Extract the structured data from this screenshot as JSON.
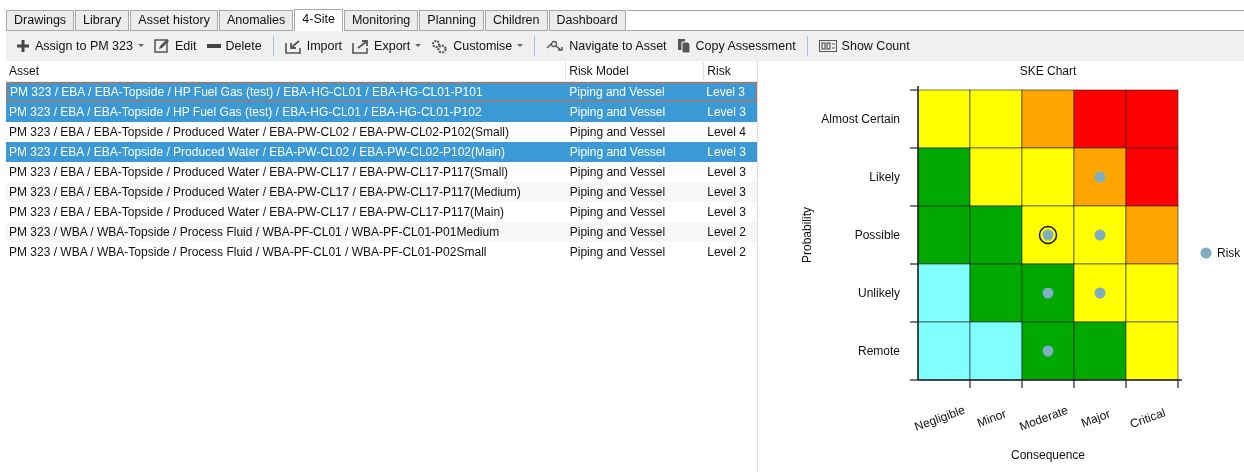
{
  "tabs": [
    {
      "label": "Drawings",
      "selected": false
    },
    {
      "label": "Library",
      "selected": false
    },
    {
      "label": "Asset history",
      "selected": false
    },
    {
      "label": "Anomalies",
      "selected": false
    },
    {
      "label": "4-Site",
      "selected": true
    },
    {
      "label": "Monitoring",
      "selected": false
    },
    {
      "label": "Planning",
      "selected": false
    },
    {
      "label": "Children",
      "selected": false
    },
    {
      "label": "Dashboard",
      "selected": false
    }
  ],
  "toolbar": [
    [
      {
        "label": "Assign to PM 323",
        "dropdown": true
      },
      {
        "label": "Edit",
        "dropdown": false
      },
      {
        "label": "Delete",
        "dropdown": false
      }
    ],
    [
      {
        "label": "Import",
        "dropdown": false
      },
      {
        "label": "Export",
        "dropdown": true
      },
      {
        "label": "Customise",
        "dropdown": true
      }
    ],
    [
      {
        "label": "Navigate to Asset",
        "dropdown": false
      },
      {
        "label": "Copy Assessment",
        "dropdown": false
      }
    ],
    [
      {
        "label": "Show Count",
        "dropdown": false
      }
    ]
  ],
  "table": {
    "columns": [
      "Asset",
      "Risk Model",
      "Risk"
    ],
    "rows": [
      {
        "cells": [
          "PM 323 / EBA / EBA-Topside / HP Fuel Gas (test) / EBA-HG-CL01 / EBA-HG-CL01-P101",
          "Piping and Vessel",
          "Level 3"
        ],
        "selected": true,
        "focused": true
      },
      {
        "cells": [
          "PM 323 / EBA / EBA-Topside / HP Fuel Gas (test) / EBA-HG-CL01 / EBA-HG-CL01-P102",
          "Piping and Vessel",
          "Level 3"
        ],
        "selected": true,
        "focused": false
      },
      {
        "cells": [
          "PM 323 / EBA / EBA-Topside / Produced Water / EBA-PW-CL02 / EBA-PW-CL02-P102(Small)",
          "Piping and Vessel",
          "Level 4"
        ],
        "selected": false,
        "focused": false
      },
      {
        "cells": [
          "PM 323 / EBA / EBA-Topside / Produced Water / EBA-PW-CL02 / EBA-PW-CL02-P102(Main)",
          "Piping and Vessel",
          "Level 3"
        ],
        "selected": true,
        "focused": false
      },
      {
        "cells": [
          "PM 323 / EBA / EBA-Topside / Produced Water / EBA-PW-CL17 / EBA-PW-CL17-P117(Small)",
          "Piping and Vessel",
          "Level 3"
        ],
        "selected": false,
        "focused": false
      },
      {
        "cells": [
          "PM 323 / EBA / EBA-Topside / Produced Water / EBA-PW-CL17 / EBA-PW-CL17-P117(Medium)",
          "Piping and Vessel",
          "Level 3"
        ],
        "selected": false,
        "focused": false
      },
      {
        "cells": [
          "PM 323 / EBA / EBA-Topside / Produced Water / EBA-PW-CL17 / EBA-PW-CL17-P117(Main)",
          "Piping and Vessel",
          "Level 3"
        ],
        "selected": false,
        "focused": false
      },
      {
        "cells": [
          "PM 323 / WBA / WBA-Topside / Process Fluid / WBA-PF-CL01 / WBA-PF-CL01-P01Medium",
          "Piping and Vessel",
          "Level 2"
        ],
        "selected": false,
        "focused": false
      },
      {
        "cells": [
          "PM 323 / WBA / WBA-Topside / Process Fluid / WBA-PF-CL01 / WBA-PF-CL01-P02Small",
          "Piping and Vessel",
          "Level 2"
        ],
        "selected": false,
        "focused": false
      }
    ]
  },
  "risk_matrix": {
    "title": "SKE Chart",
    "xlabel": "Consequence",
    "ylabel": "Probability",
    "columns": [
      "Negligible",
      "Minor",
      "Moderate",
      "Major",
      "Critical"
    ],
    "rows": [
      {
        "label": "Almost Certain",
        "cells": [
          {
            "color": "#ffff00",
            "marked": false,
            "selected": false
          },
          {
            "color": "#ffff00",
            "marked": false,
            "selected": false
          },
          {
            "color": "#ffa500",
            "marked": false,
            "selected": false
          },
          {
            "color": "#ff0000",
            "marked": false,
            "selected": false
          },
          {
            "color": "#ff0000",
            "marked": false,
            "selected": false
          }
        ]
      },
      {
        "label": "Likely",
        "cells": [
          {
            "color": "#00a800",
            "marked": false,
            "selected": false
          },
          {
            "color": "#ffff00",
            "marked": false,
            "selected": false
          },
          {
            "color": "#ffff00",
            "marked": false,
            "selected": false
          },
          {
            "color": "#ffa500",
            "marked": true,
            "selected": false
          },
          {
            "color": "#ff0000",
            "marked": false,
            "selected": false
          }
        ]
      },
      {
        "label": "Possible",
        "cells": [
          {
            "color": "#00a800",
            "marked": false,
            "selected": false
          },
          {
            "color": "#00a800",
            "marked": false,
            "selected": false
          },
          {
            "color": "#ffff00",
            "marked": true,
            "selected": true
          },
          {
            "color": "#ffff00",
            "marked": true,
            "selected": false
          },
          {
            "color": "#ffa500",
            "marked": false,
            "selected": false
          }
        ]
      },
      {
        "label": "Unlikely",
        "cells": [
          {
            "color": "#80ffff",
            "marked": false,
            "selected": false
          },
          {
            "color": "#00a800",
            "marked": false,
            "selected": false
          },
          {
            "color": "#00a800",
            "marked": true,
            "selected": false
          },
          {
            "color": "#ffff00",
            "marked": true,
            "selected": false
          },
          {
            "color": "#ffff00",
            "marked": false,
            "selected": false
          }
        ]
      },
      {
        "label": "Remote",
        "cells": [
          {
            "color": "#80ffff",
            "marked": false,
            "selected": false
          },
          {
            "color": "#80ffff",
            "marked": false,
            "selected": false
          },
          {
            "color": "#00a800",
            "marked": true,
            "selected": false
          },
          {
            "color": "#00a800",
            "marked": false,
            "selected": false
          },
          {
            "color": "#ffff00",
            "marked": false,
            "selected": false
          }
        ]
      }
    ],
    "legend": [
      {
        "label": "Risk",
        "color": "#7fadc2"
      }
    ]
  }
}
